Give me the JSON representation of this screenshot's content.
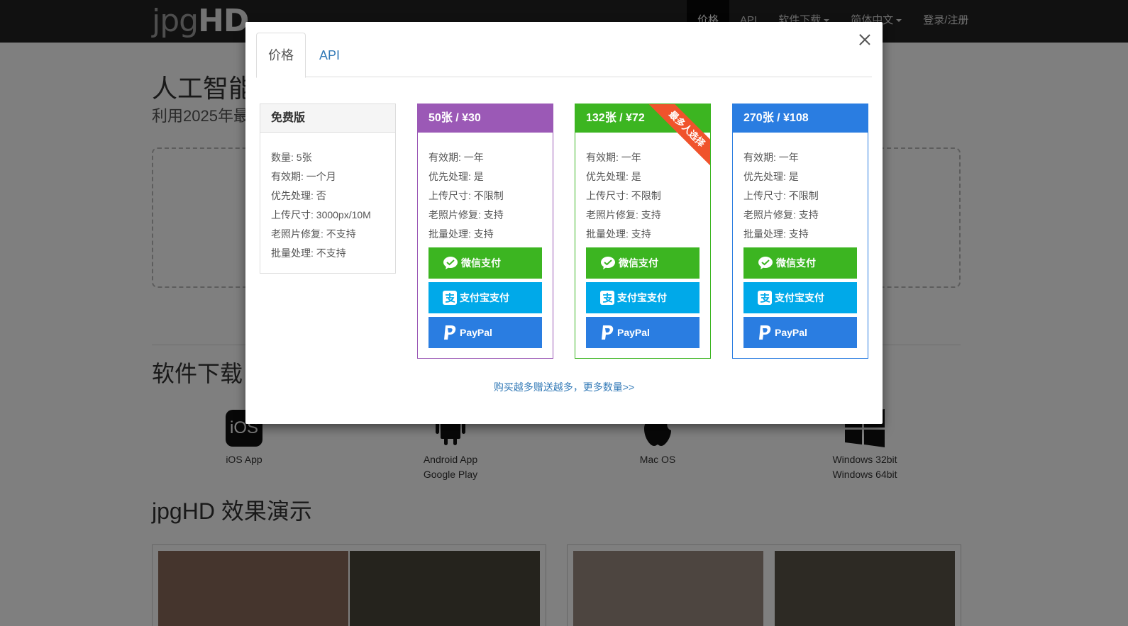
{
  "navbar": {
    "logo_light": "jpg",
    "logo_bold": "HD",
    "items": [
      {
        "label": "价格"
      },
      {
        "label": "API"
      },
      {
        "label": "软件下载"
      },
      {
        "label": "简体中文"
      },
      {
        "label": "登录/注册"
      }
    ]
  },
  "background": {
    "title": "人工智能",
    "subtitle": "利用2025年最",
    "download_heading": "软件下载",
    "downloads": [
      {
        "icon": "ios-icon",
        "icon_text": "iOS",
        "line1": "iOS App",
        "line2": ""
      },
      {
        "icon": "android-icon",
        "line1": "Android App",
        "line2": "Google Play"
      },
      {
        "icon": "apple-icon",
        "line1": "Mac OS",
        "line2": ""
      },
      {
        "icon": "windows-icon",
        "line1": "Windows 32bit",
        "line2": "Windows 64bit"
      }
    ],
    "demo_heading": "jpgHD 效果演示"
  },
  "modal": {
    "tabs": [
      {
        "label": "价格",
        "active": true
      },
      {
        "label": "API",
        "active": false
      }
    ],
    "free_plan": {
      "title": "免费版",
      "features": [
        "数量: 5张",
        "有效期: 一个月",
        "优先处理: 否",
        "上传尺寸: 3000px/10M",
        "老照片修复: 不支持",
        "批量处理: 不支持"
      ]
    },
    "paid_plans": [
      {
        "title": "50张 / ¥30",
        "color": "#9b59b6",
        "features": [
          "有效期: 一年",
          "优先处理: 是",
          "上传尺寸: 不限制",
          "老照片修复: 支持",
          "批量处理: 支持"
        ]
      },
      {
        "title": "132张 / ¥72",
        "color": "#3cb521",
        "ribbon": "最多人选择",
        "features": [
          "有效期: 一年",
          "优先处理: 是",
          "上传尺寸: 不限制",
          "老照片修复: 支持",
          "批量处理: 支持"
        ]
      },
      {
        "title": "270张 / ¥108",
        "color": "#2a7de1",
        "features": [
          "有效期: 一年",
          "优先处理: 是",
          "上传尺寸: 不限制",
          "老照片修复: 支持",
          "批量处理: 支持"
        ]
      }
    ],
    "buttons": {
      "wechat": "微信支付",
      "alipay": "支付宝支付",
      "paypal": "PayPal"
    },
    "more_link": "购买越多赠送越多，更多数量>>"
  }
}
